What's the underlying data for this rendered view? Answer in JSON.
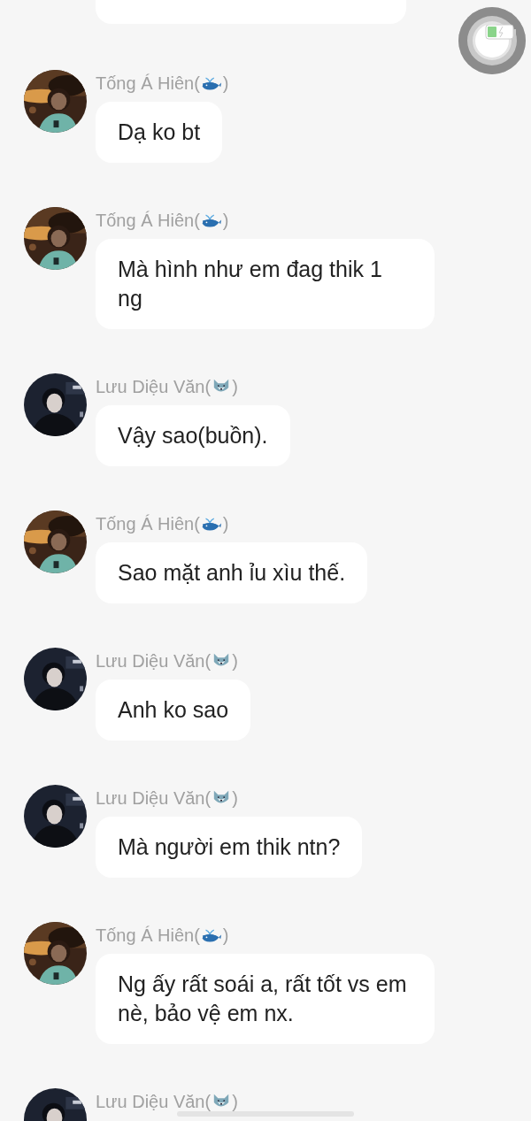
{
  "messages": [
    {
      "kind": "whale",
      "name": "Tống Á Hiên(",
      "name_end": ")",
      "text": "Dạ ko bt"
    },
    {
      "kind": "whale",
      "name": "Tống Á Hiên(",
      "name_end": ")",
      "text": "Mà hình như em đag thik 1 ng"
    },
    {
      "kind": "wolf",
      "name": "Lưu Diệu Văn(",
      "name_end": ")",
      "text": "Vậy sao(buồn)."
    },
    {
      "kind": "whale",
      "name": "Tống Á Hiên(",
      "name_end": ")",
      "text": "Sao mặt anh ỉu xìu thế."
    },
    {
      "kind": "wolf",
      "name": "Lưu Diệu Văn(",
      "name_end": ")",
      "text": "Anh ko sao"
    },
    {
      "kind": "wolf",
      "name": "Lưu Diệu Văn(",
      "name_end": ")",
      "text": "Mà người em thik ntn?"
    },
    {
      "kind": "whale",
      "name": "Tống Á Hiên(",
      "name_end": ")",
      "text": "Ng ấy rất soái a, rất tốt vs em nè, bảo vệ em nx."
    },
    {
      "kind": "wolf",
      "name": "Lưu Diệu Văn(",
      "name_end": ")"
    }
  ]
}
